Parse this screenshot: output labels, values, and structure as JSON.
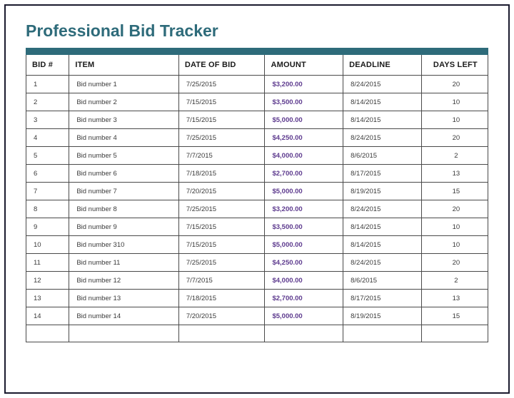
{
  "title": "Professional Bid Tracker",
  "columns": {
    "bid_num": "BID #",
    "item": "ITEM",
    "date_of_bid": "DATE OF BID",
    "amount": "AMOUNT",
    "deadline": "DEADLINE",
    "days_left": "DAYS LEFT"
  },
  "chart_data": {
    "type": "table",
    "title": "Professional Bid Tracker",
    "columns": [
      "BID #",
      "ITEM",
      "DATE OF BID",
      "AMOUNT",
      "DEADLINE",
      "DAYS LEFT"
    ],
    "rows": [
      {
        "bid_num": "1",
        "item": "Bid number 1",
        "date_of_bid": "7/25/2015",
        "amount": "$3,200.00",
        "deadline": "8/24/2015",
        "days_left": "20"
      },
      {
        "bid_num": "2",
        "item": "Bid number 2",
        "date_of_bid": "7/15/2015",
        "amount": "$3,500.00",
        "deadline": "8/14/2015",
        "days_left": "10"
      },
      {
        "bid_num": "3",
        "item": "Bid number 3",
        "date_of_bid": "7/15/2015",
        "amount": "$5,000.00",
        "deadline": "8/14/2015",
        "days_left": "10"
      },
      {
        "bid_num": "4",
        "item": "Bid number 4",
        "date_of_bid": "7/25/2015",
        "amount": "$4,250.00",
        "deadline": "8/24/2015",
        "days_left": "20"
      },
      {
        "bid_num": "5",
        "item": "Bid number 5",
        "date_of_bid": "7/7/2015",
        "amount": "$4,000.00",
        "deadline": "8/6/2015",
        "days_left": "2"
      },
      {
        "bid_num": "6",
        "item": "Bid number 6",
        "date_of_bid": "7/18/2015",
        "amount": "$2,700.00",
        "deadline": "8/17/2015",
        "days_left": "13"
      },
      {
        "bid_num": "7",
        "item": "Bid number 7",
        "date_of_bid": "7/20/2015",
        "amount": "$5,000.00",
        "deadline": "8/19/2015",
        "days_left": "15"
      },
      {
        "bid_num": "8",
        "item": "Bid number 8",
        "date_of_bid": "7/25/2015",
        "amount": "$3,200.00",
        "deadline": "8/24/2015",
        "days_left": "20"
      },
      {
        "bid_num": "9",
        "item": "Bid number 9",
        "date_of_bid": "7/15/2015",
        "amount": "$3,500.00",
        "deadline": "8/14/2015",
        "days_left": "10"
      },
      {
        "bid_num": "10",
        "item": "Bid number 310",
        "date_of_bid": "7/15/2015",
        "amount": "$5,000.00",
        "deadline": "8/14/2015",
        "days_left": "10"
      },
      {
        "bid_num": "11",
        "item": "Bid number 11",
        "date_of_bid": "7/25/2015",
        "amount": "$4,250.00",
        "deadline": "8/24/2015",
        "days_left": "20"
      },
      {
        "bid_num": "12",
        "item": "Bid number 12",
        "date_of_bid": "7/7/2015",
        "amount": "$4,000.00",
        "deadline": "8/6/2015",
        "days_left": "2"
      },
      {
        "bid_num": "13",
        "item": "Bid number 13",
        "date_of_bid": "7/18/2015",
        "amount": "$2,700.00",
        "deadline": "8/17/2015",
        "days_left": "13"
      },
      {
        "bid_num": "14",
        "item": "Bid number 14",
        "date_of_bid": "7/20/2015",
        "amount": "$5,000.00",
        "deadline": "8/19/2015",
        "days_left": "15"
      }
    ]
  }
}
